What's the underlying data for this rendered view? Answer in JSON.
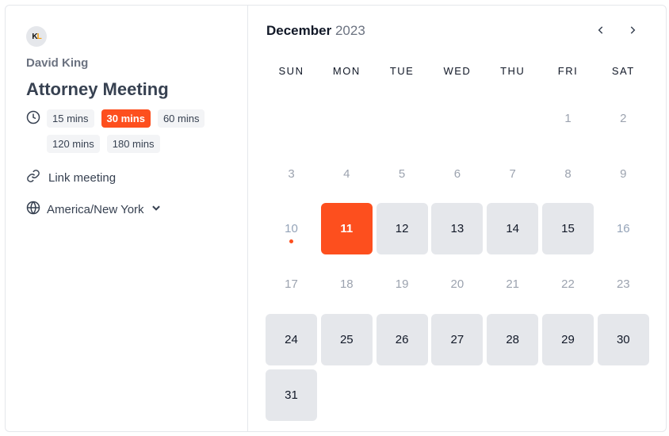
{
  "profile": {
    "logo_text": "KL",
    "owner": "David King",
    "title": "Attorney Meeting"
  },
  "durations": [
    {
      "label": "15 mins",
      "selected": false
    },
    {
      "label": "30 mins",
      "selected": true
    },
    {
      "label": "60 mins",
      "selected": false
    },
    {
      "label": "120 mins",
      "selected": false
    },
    {
      "label": "180 mins",
      "selected": false
    }
  ],
  "location": "Link meeting",
  "timezone": "America/New York",
  "calendar": {
    "month": "December",
    "year": "2023",
    "prev_icon": "‹",
    "next_icon": "›",
    "weekdays": [
      "SUN",
      "MON",
      "TUE",
      "WED",
      "THU",
      "FRI",
      "SAT"
    ],
    "leading_blanks": 5,
    "days": [
      {
        "d": "1",
        "s": "disabled"
      },
      {
        "d": "2",
        "s": "disabled"
      },
      {
        "d": "3",
        "s": "disabled"
      },
      {
        "d": "4",
        "s": "disabled"
      },
      {
        "d": "5",
        "s": "disabled"
      },
      {
        "d": "6",
        "s": "disabled"
      },
      {
        "d": "7",
        "s": "disabled"
      },
      {
        "d": "8",
        "s": "disabled"
      },
      {
        "d": "9",
        "s": "disabled"
      },
      {
        "d": "10",
        "s": "today"
      },
      {
        "d": "11",
        "s": "selected"
      },
      {
        "d": "12",
        "s": "available"
      },
      {
        "d": "13",
        "s": "available"
      },
      {
        "d": "14",
        "s": "available"
      },
      {
        "d": "15",
        "s": "available"
      },
      {
        "d": "16",
        "s": "today"
      },
      {
        "d": "17",
        "s": "disabled"
      },
      {
        "d": "18",
        "s": "disabled"
      },
      {
        "d": "19",
        "s": "disabled"
      },
      {
        "d": "20",
        "s": "disabled"
      },
      {
        "d": "21",
        "s": "disabled"
      },
      {
        "d": "22",
        "s": "disabled"
      },
      {
        "d": "23",
        "s": "disabled"
      },
      {
        "d": "24",
        "s": "available"
      },
      {
        "d": "25",
        "s": "available"
      },
      {
        "d": "26",
        "s": "available"
      },
      {
        "d": "27",
        "s": "available"
      },
      {
        "d": "28",
        "s": "available"
      },
      {
        "d": "29",
        "s": "available"
      },
      {
        "d": "30",
        "s": "available"
      },
      {
        "d": "31",
        "s": "available"
      }
    ]
  },
  "colors": {
    "accent": "#fd4f1e",
    "available_bg": "#e5e7eb"
  }
}
